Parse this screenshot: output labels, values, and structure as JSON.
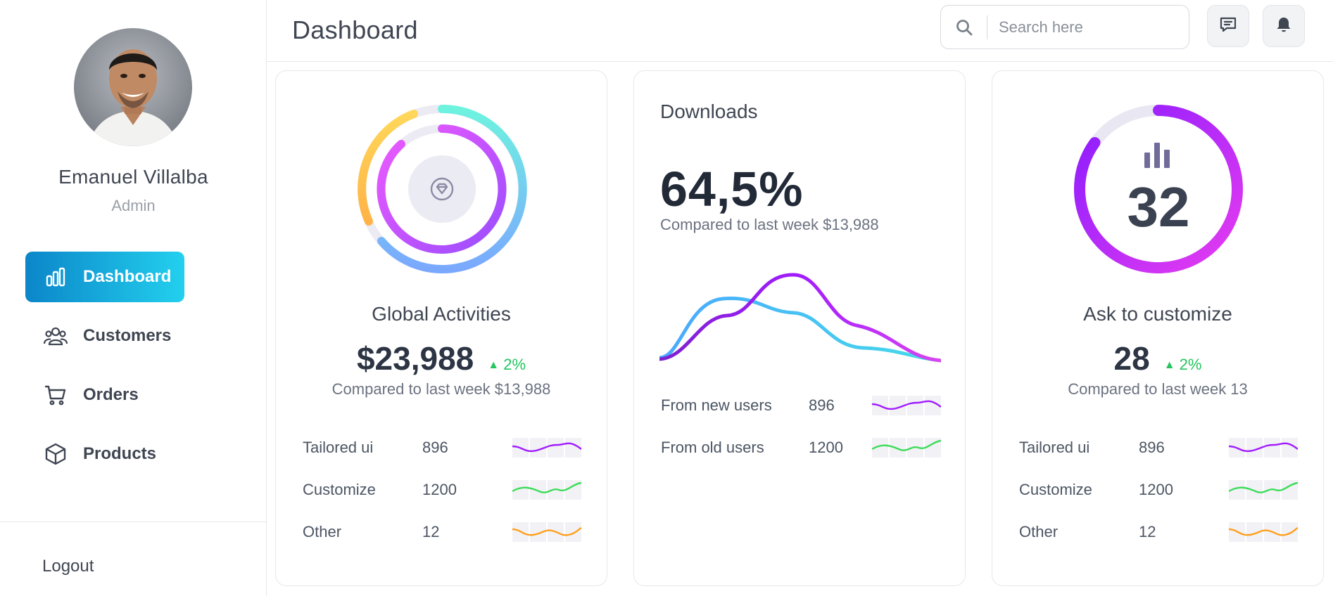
{
  "profile": {
    "name": "Emanuel Villalba",
    "role": "Admin"
  },
  "nav": {
    "items": [
      {
        "label": "Dashboard",
        "icon": "bar-chart-icon",
        "active": true
      },
      {
        "label": "Customers",
        "icon": "users-icon",
        "active": false
      },
      {
        "label": "Orders",
        "icon": "cart-icon",
        "active": false
      },
      {
        "label": "Products",
        "icon": "box-icon",
        "active": false
      }
    ],
    "logout": "Logout"
  },
  "header": {
    "title": "Dashboard",
    "search_placeholder": "Search here",
    "buttons": [
      "message-icon",
      "bell-icon"
    ]
  },
  "colors": {
    "accent_start": "#0b86c9",
    "accent_end": "#23d0ee",
    "positive": "#22c55e",
    "purple": "#a21cff",
    "magenta": "#e040fb",
    "green": "#3ddc5a",
    "orange": "#ff9f1c",
    "blue": "#4aa8ff"
  },
  "cards": {
    "global": {
      "title": "Global Activities",
      "value": "$23,988",
      "delta": "2%",
      "compare": "Compared to last week $13,988",
      "rows": [
        {
          "label": "Tailored ui",
          "value": "896",
          "color": "#a21cff"
        },
        {
          "label": "Customize",
          "value": "1200",
          "color": "#3ddc5a"
        },
        {
          "label": "Other",
          "value": "12",
          "color": "#ff9f1c"
        }
      ]
    },
    "downloads": {
      "title": "Downloads",
      "value": "64,5%",
      "compare": "Compared to last week $13,988",
      "rows": [
        {
          "label": "From new users",
          "value": "896",
          "color": "#a21cff"
        },
        {
          "label": "From old users",
          "value": "1200",
          "color": "#3ddc5a"
        }
      ]
    },
    "customize": {
      "ring_value": "32",
      "ring_fraction": 0.85,
      "title": "Ask to customize",
      "value": "28",
      "delta": "2%",
      "compare": "Compared to last week 13",
      "rows": [
        {
          "label": "Tailored ui",
          "value": "896",
          "color": "#a21cff"
        },
        {
          "label": "Customize",
          "value": "1200",
          "color": "#3ddc5a"
        },
        {
          "label": "Other",
          "value": "12",
          "color": "#ff9f1c"
        }
      ]
    }
  }
}
